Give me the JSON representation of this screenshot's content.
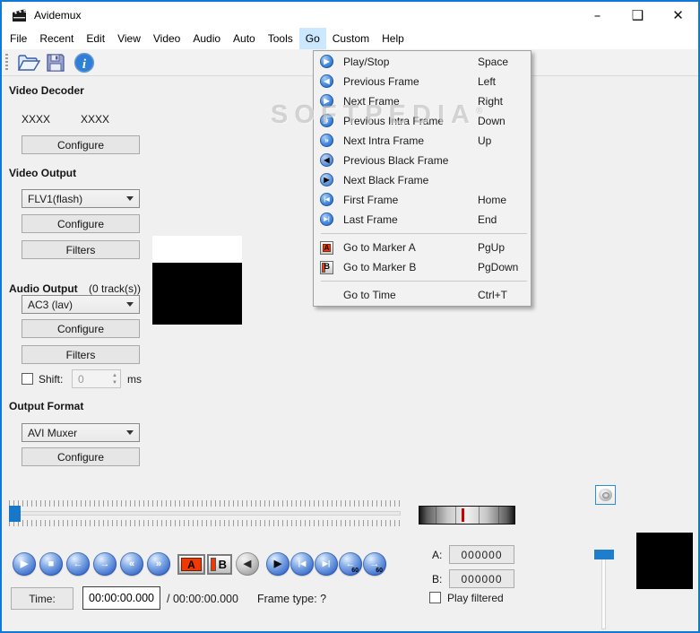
{
  "window": {
    "title": "Avidemux",
    "minimize": "–",
    "maximize": "❑",
    "close": "✕"
  },
  "menubar": {
    "items": [
      {
        "label": "File"
      },
      {
        "label": "Recent"
      },
      {
        "label": "Edit"
      },
      {
        "label": "View"
      },
      {
        "label": "Video"
      },
      {
        "label": "Audio"
      },
      {
        "label": "Auto"
      },
      {
        "label": "Tools"
      },
      {
        "label": "Go"
      },
      {
        "label": "Custom"
      },
      {
        "label": "Help"
      }
    ],
    "active_item": "Go"
  },
  "toolbar": {
    "icons": [
      "open-file-icon",
      "save-file-icon",
      "info-icon"
    ]
  },
  "video_decoder": {
    "heading": "Video Decoder",
    "value_left": "XXXX",
    "value_right": "XXXX",
    "configure": "Configure"
  },
  "video_output": {
    "heading": "Video Output",
    "codec": "FLV1(flash)",
    "configure": "Configure",
    "filters": "Filters"
  },
  "audio_output": {
    "heading": "Audio Output",
    "tracks": "(0 track(s))",
    "codec": "AC3 (lav)",
    "configure": "Configure",
    "filters": "Filters",
    "shift_label": "Shift:",
    "shift_value": "0",
    "shift_unit": "ms"
  },
  "output_format": {
    "heading": "Output Format",
    "muxer": "AVI Muxer",
    "configure": "Configure"
  },
  "go_menu": {
    "items": [
      {
        "label": "Play/Stop",
        "shortcut": "Space",
        "glyph": "▶",
        "icon": "play-circle-icon"
      },
      {
        "label": "Previous Frame",
        "shortcut": "Left",
        "glyph": "◀",
        "icon": "previous-frame-icon"
      },
      {
        "label": "Next Frame",
        "shortcut": "Right",
        "glyph": "▶",
        "icon": "next-frame-icon"
      },
      {
        "label": "Previous Intra Frame",
        "shortcut": "Down",
        "glyph": "«",
        "icon": "previous-intra-frame-icon"
      },
      {
        "label": "Next Intra Frame",
        "shortcut": "Up",
        "glyph": "»",
        "icon": "next-intra-frame-icon"
      },
      {
        "label": "Previous Black Frame",
        "shortcut": "",
        "glyph": "◀",
        "icon": "previous-black-frame-icon"
      },
      {
        "label": "Next Black Frame",
        "shortcut": "",
        "glyph": "▶",
        "icon": "next-black-frame-icon"
      },
      {
        "label": "First Frame",
        "shortcut": "Home",
        "glyph": "|◀",
        "icon": "first-frame-icon"
      },
      {
        "label": "Last Frame",
        "shortcut": "End",
        "glyph": "▶|",
        "icon": "last-frame-icon"
      },
      {
        "label": "Go to Marker A",
        "shortcut": "PgUp",
        "glyph": "A",
        "icon": "marker-a-icon"
      },
      {
        "label": "Go to Marker B",
        "shortcut": "PgDown",
        "glyph": "B",
        "icon": "marker-b-icon"
      },
      {
        "label": "Go to Time",
        "shortcut": "Ctrl+T",
        "glyph": "",
        "icon": ""
      }
    ]
  },
  "transport": {
    "buttons": [
      {
        "name": "play-button",
        "glyph": "▶"
      },
      {
        "name": "stop-button",
        "glyph": "■"
      },
      {
        "name": "previous-frame-button",
        "glyph": "←"
      },
      {
        "name": "next-frame-button",
        "glyph": "→"
      },
      {
        "name": "previous-intra-frame-button",
        "glyph": "«"
      },
      {
        "name": "next-intra-frame-button",
        "glyph": "»"
      },
      {
        "name": "marker-a-button",
        "glyph": "A"
      },
      {
        "name": "marker-b-button",
        "glyph": "B"
      },
      {
        "name": "previous-black-frame-button",
        "glyph": "◀"
      },
      {
        "name": "next-black-frame-button",
        "glyph": "▶"
      },
      {
        "name": "first-frame-button",
        "glyph": "|◀"
      },
      {
        "name": "last-frame-button",
        "glyph": "▶|"
      },
      {
        "name": "back-one-minute-button",
        "glyph": "←",
        "sub": "60"
      },
      {
        "name": "forward-one-minute-button",
        "glyph": "→",
        "sub": "60"
      }
    ]
  },
  "selection": {
    "a_label": "A:",
    "a_value": "000000",
    "b_label": "B:",
    "b_value": "000000",
    "play_filtered": "Play filtered"
  },
  "time_row": {
    "label": "Time:",
    "current": "00:00:00.000",
    "total": "/ 00:00:00.000",
    "frame_type": "Frame type:  ?"
  },
  "watermark": "SOFTPEDIA",
  "colors": {
    "accent": "#1079d8",
    "menu_highlight": "#cce8ff",
    "marker_red": "#f03800",
    "handle_blue": "#1777c9"
  }
}
